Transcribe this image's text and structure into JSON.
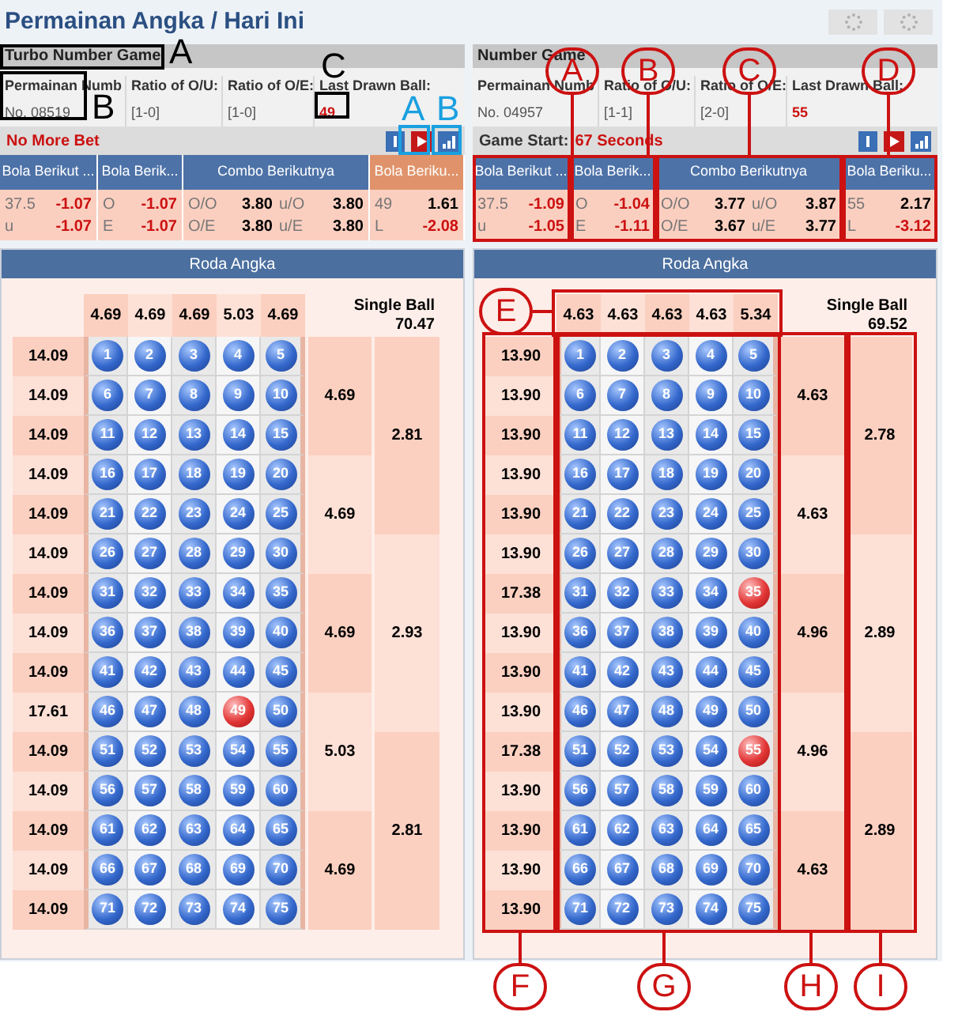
{
  "page_title": "Permainan Angka / Hari Ini",
  "panels": [
    {
      "title": "Turbo Number Game",
      "info": [
        {
          "label": "Permainan Numb",
          "value": "No. 08519"
        },
        {
          "label": "Ratio of O/U:",
          "value": "[1-0]"
        },
        {
          "label": "Ratio of O/E:",
          "value": "[1-0]"
        },
        {
          "label": "Last Drawn Ball:",
          "value": "49"
        }
      ],
      "status": {
        "value": "No More Bet"
      },
      "markets": [
        {
          "title": "Bola Berikut ...",
          "highlighted": false,
          "lines": [
            [
              {
                "text": "37.5",
                "kind": "label"
              },
              {
                "text": "-1.07",
                "kind": "neg"
              }
            ],
            [
              {
                "text": "u",
                "kind": "label"
              },
              {
                "text": "-1.07",
                "kind": "neg"
              }
            ]
          ]
        },
        {
          "title": "Bola Berik...",
          "highlighted": false,
          "lines": [
            [
              {
                "text": "O",
                "kind": "label"
              },
              {
                "text": "-1.07",
                "kind": "neg"
              }
            ],
            [
              {
                "text": "E",
                "kind": "label"
              },
              {
                "text": "-1.07",
                "kind": "neg"
              }
            ]
          ]
        },
        {
          "title": "Combo Berikutnya",
          "highlighted": false,
          "lines": [
            [
              {
                "text": "O/O",
                "kind": "label"
              },
              {
                "text": "3.80",
                "kind": "pos"
              },
              {
                "text": "u/O",
                "kind": "label"
              },
              {
                "text": "3.80",
                "kind": "pos"
              }
            ],
            [
              {
                "text": "O/E",
                "kind": "label"
              },
              {
                "text": "3.80",
                "kind": "pos"
              },
              {
                "text": "u/E",
                "kind": "label"
              },
              {
                "text": "3.80",
                "kind": "pos"
              }
            ]
          ]
        },
        {
          "title": "Bola Beriku...",
          "highlighted": true,
          "lines": [
            [
              {
                "text": "49",
                "kind": "label"
              },
              {
                "text": "1.61",
                "kind": "pos"
              }
            ],
            [
              {
                "text": "L",
                "kind": "label"
              },
              {
                "text": "-2.08",
                "kind": "neg"
              }
            ]
          ]
        }
      ],
      "grid": {
        "title": "Roda Angka",
        "column_odds": [
          "4.69",
          "4.69",
          "4.69",
          "5.03",
          "4.69"
        ],
        "single_label": "Single Ball",
        "single_odds": "70.47",
        "row_odds": [
          "14.09",
          "14.09",
          "14.09",
          "14.09",
          "14.09",
          "14.09",
          "14.09",
          "14.09",
          "14.09",
          "17.61",
          "14.09",
          "14.09",
          "14.09",
          "14.09",
          "14.09"
        ],
        "balls": [
          {
            "text": "1",
            "hit": false
          },
          {
            "text": "2",
            "hit": false
          },
          {
            "text": "3",
            "hit": false
          },
          {
            "text": "4",
            "hit": false
          },
          {
            "text": "5",
            "hit": false
          },
          {
            "text": "6",
            "hit": false
          },
          {
            "text": "7",
            "hit": false
          },
          {
            "text": "8",
            "hit": false
          },
          {
            "text": "9",
            "hit": false
          },
          {
            "text": "10",
            "hit": false
          },
          {
            "text": "11",
            "hit": false
          },
          {
            "text": "12",
            "hit": false
          },
          {
            "text": "13",
            "hit": false
          },
          {
            "text": "14",
            "hit": false
          },
          {
            "text": "15",
            "hit": false
          },
          {
            "text": "16",
            "hit": false
          },
          {
            "text": "17",
            "hit": false
          },
          {
            "text": "18",
            "hit": false
          },
          {
            "text": "19",
            "hit": false
          },
          {
            "text": "20",
            "hit": false
          },
          {
            "text": "21",
            "hit": false
          },
          {
            "text": "22",
            "hit": false
          },
          {
            "text": "23",
            "hit": false
          },
          {
            "text": "24",
            "hit": false
          },
          {
            "text": "25",
            "hit": false
          },
          {
            "text": "26",
            "hit": false
          },
          {
            "text": "27",
            "hit": false
          },
          {
            "text": "28",
            "hit": false
          },
          {
            "text": "29",
            "hit": false
          },
          {
            "text": "30",
            "hit": false
          },
          {
            "text": "31",
            "hit": false
          },
          {
            "text": "32",
            "hit": false
          },
          {
            "text": "33",
            "hit": false
          },
          {
            "text": "34",
            "hit": false
          },
          {
            "text": "35",
            "hit": false
          },
          {
            "text": "36",
            "hit": false
          },
          {
            "text": "37",
            "hit": false
          },
          {
            "text": "38",
            "hit": false
          },
          {
            "text": "39",
            "hit": false
          },
          {
            "text": "40",
            "hit": false
          },
          {
            "text": "41",
            "hit": false
          },
          {
            "text": "42",
            "hit": false
          },
          {
            "text": "43",
            "hit": false
          },
          {
            "text": "44",
            "hit": false
          },
          {
            "text": "45",
            "hit": false
          },
          {
            "text": "46",
            "hit": false
          },
          {
            "text": "47",
            "hit": false
          },
          {
            "text": "48",
            "hit": false
          },
          {
            "text": "49",
            "hit": true
          },
          {
            "text": "50",
            "hit": false
          },
          {
            "text": "51",
            "hit": false
          },
          {
            "text": "52",
            "hit": false
          },
          {
            "text": "53",
            "hit": false
          },
          {
            "text": "54",
            "hit": false
          },
          {
            "text": "55",
            "hit": false
          },
          {
            "text": "56",
            "hit": false
          },
          {
            "text": "57",
            "hit": false
          },
          {
            "text": "58",
            "hit": false
          },
          {
            "text": "59",
            "hit": false
          },
          {
            "text": "60",
            "hit": false
          },
          {
            "text": "61",
            "hit": false
          },
          {
            "text": "62",
            "hit": false
          },
          {
            "text": "63",
            "hit": false
          },
          {
            "text": "64",
            "hit": false
          },
          {
            "text": "65",
            "hit": false
          },
          {
            "text": "66",
            "hit": false
          },
          {
            "text": "67",
            "hit": false
          },
          {
            "text": "68",
            "hit": false
          },
          {
            "text": "69",
            "hit": false
          },
          {
            "text": "70",
            "hit": false
          },
          {
            "text": "71",
            "hit": false
          },
          {
            "text": "72",
            "hit": false
          },
          {
            "text": "73",
            "hit": false
          },
          {
            "text": "74",
            "hit": false
          },
          {
            "text": "75",
            "hit": false
          }
        ],
        "groups": [
          "4.69",
          "4.69",
          "4.69",
          "5.03",
          "4.69"
        ],
        "singles": [
          "2.81",
          "2.93",
          "2.81"
        ]
      }
    },
    {
      "title": "Number Game",
      "info": [
        {
          "label": "Permainan Numb",
          "value": "No. 04957"
        },
        {
          "label": "Ratio of O/U:",
          "value": "[1-1]"
        },
        {
          "label": "Ratio of O/E:",
          "value": "[2-0]"
        },
        {
          "label": "Last Drawn Ball:",
          "value": "55"
        }
      ],
      "status": {
        "label": "Game Start:",
        "value": "67 Seconds"
      },
      "markets": [
        {
          "title": "Bola Berikut ...",
          "highlighted": false,
          "lines": [
            [
              {
                "text": "37.5",
                "kind": "label"
              },
              {
                "text": "-1.09",
                "kind": "neg"
              }
            ],
            [
              {
                "text": "u",
                "kind": "label"
              },
              {
                "text": "-1.05",
                "kind": "neg"
              }
            ]
          ]
        },
        {
          "title": "Bola Berik...",
          "highlighted": false,
          "lines": [
            [
              {
                "text": "O",
                "kind": "label"
              },
              {
                "text": "-1.04",
                "kind": "neg"
              }
            ],
            [
              {
                "text": "E",
                "kind": "label"
              },
              {
                "text": "-1.11",
                "kind": "neg"
              }
            ]
          ]
        },
        {
          "title": "Combo Berikutnya",
          "highlighted": false,
          "lines": [
            [
              {
                "text": "O/O",
                "kind": "label"
              },
              {
                "text": "3.77",
                "kind": "pos"
              },
              {
                "text": "u/O",
                "kind": "label"
              },
              {
                "text": "3.87",
                "kind": "pos"
              }
            ],
            [
              {
                "text": "O/E",
                "kind": "label"
              },
              {
                "text": "3.67",
                "kind": "pos"
              },
              {
                "text": "u/E",
                "kind": "label"
              },
              {
                "text": "3.77",
                "kind": "pos"
              }
            ]
          ]
        },
        {
          "title": "Bola Beriku...",
          "highlighted": false,
          "lines": [
            [
              {
                "text": "55",
                "kind": "label"
              },
              {
                "text": "2.17",
                "kind": "pos"
              }
            ],
            [
              {
                "text": "L",
                "kind": "label"
              },
              {
                "text": "-3.12",
                "kind": "neg"
              }
            ]
          ]
        }
      ],
      "grid": {
        "title": "Roda Angka",
        "column_odds": [
          "4.63",
          "4.63",
          "4.63",
          "4.63",
          "5.34"
        ],
        "single_label": "Single Ball",
        "single_odds": "69.52",
        "row_odds": [
          "13.90",
          "13.90",
          "13.90",
          "13.90",
          "13.90",
          "13.90",
          "17.38",
          "13.90",
          "13.90",
          "13.90",
          "17.38",
          "13.90",
          "13.90",
          "13.90",
          "13.90"
        ],
        "balls": [
          {
            "text": "1",
            "hit": false
          },
          {
            "text": "2",
            "hit": false
          },
          {
            "text": "3",
            "hit": false
          },
          {
            "text": "4",
            "hit": false
          },
          {
            "text": "5",
            "hit": false
          },
          {
            "text": "6",
            "hit": false
          },
          {
            "text": "7",
            "hit": false
          },
          {
            "text": "8",
            "hit": false
          },
          {
            "text": "9",
            "hit": false
          },
          {
            "text": "10",
            "hit": false
          },
          {
            "text": "11",
            "hit": false
          },
          {
            "text": "12",
            "hit": false
          },
          {
            "text": "13",
            "hit": false
          },
          {
            "text": "14",
            "hit": false
          },
          {
            "text": "15",
            "hit": false
          },
          {
            "text": "16",
            "hit": false
          },
          {
            "text": "17",
            "hit": false
          },
          {
            "text": "18",
            "hit": false
          },
          {
            "text": "19",
            "hit": false
          },
          {
            "text": "20",
            "hit": false
          },
          {
            "text": "21",
            "hit": false
          },
          {
            "text": "22",
            "hit": false
          },
          {
            "text": "23",
            "hit": false
          },
          {
            "text": "24",
            "hit": false
          },
          {
            "text": "25",
            "hit": false
          },
          {
            "text": "26",
            "hit": false
          },
          {
            "text": "27",
            "hit": false
          },
          {
            "text": "28",
            "hit": false
          },
          {
            "text": "29",
            "hit": false
          },
          {
            "text": "30",
            "hit": false
          },
          {
            "text": "31",
            "hit": false
          },
          {
            "text": "32",
            "hit": false
          },
          {
            "text": "33",
            "hit": false
          },
          {
            "text": "34",
            "hit": false
          },
          {
            "text": "35",
            "hit": true
          },
          {
            "text": "36",
            "hit": false
          },
          {
            "text": "37",
            "hit": false
          },
          {
            "text": "38",
            "hit": false
          },
          {
            "text": "39",
            "hit": false
          },
          {
            "text": "40",
            "hit": false
          },
          {
            "text": "41",
            "hit": false
          },
          {
            "text": "42",
            "hit": false
          },
          {
            "text": "43",
            "hit": false
          },
          {
            "text": "44",
            "hit": false
          },
          {
            "text": "45",
            "hit": false
          },
          {
            "text": "46",
            "hit": false
          },
          {
            "text": "47",
            "hit": false
          },
          {
            "text": "48",
            "hit": false
          },
          {
            "text": "49",
            "hit": false
          },
          {
            "text": "50",
            "hit": false
          },
          {
            "text": "51",
            "hit": false
          },
          {
            "text": "52",
            "hit": false
          },
          {
            "text": "53",
            "hit": false
          },
          {
            "text": "54",
            "hit": false
          },
          {
            "text": "55",
            "hit": true
          },
          {
            "text": "56",
            "hit": false
          },
          {
            "text": "57",
            "hit": false
          },
          {
            "text": "58",
            "hit": false
          },
          {
            "text": "59",
            "hit": false
          },
          {
            "text": "60",
            "hit": false
          },
          {
            "text": "61",
            "hit": false
          },
          {
            "text": "62",
            "hit": false
          },
          {
            "text": "63",
            "hit": false
          },
          {
            "text": "64",
            "hit": false
          },
          {
            "text": "65",
            "hit": false
          },
          {
            "text": "66",
            "hit": false
          },
          {
            "text": "67",
            "hit": false
          },
          {
            "text": "68",
            "hit": false
          },
          {
            "text": "69",
            "hit": false
          },
          {
            "text": "70",
            "hit": false
          },
          {
            "text": "71",
            "hit": false
          },
          {
            "text": "72",
            "hit": false
          },
          {
            "text": "73",
            "hit": false
          },
          {
            "text": "74",
            "hit": false
          },
          {
            "text": "75",
            "hit": false
          }
        ],
        "groups": [
          "4.63",
          "4.63",
          "4.96",
          "4.96",
          "4.63"
        ],
        "singles": [
          "2.78",
          "2.89",
          "2.89"
        ]
      }
    }
  ],
  "annotations": [
    {
      "label": "A",
      "kind": "black"
    },
    {
      "label": "B",
      "kind": "black"
    },
    {
      "label": "C",
      "kind": "black"
    },
    {
      "label": "A",
      "kind": "cyan"
    },
    {
      "label": "B",
      "kind": "cyan"
    },
    {
      "label": "A",
      "kind": "red"
    },
    {
      "label": "B",
      "kind": "red"
    },
    {
      "label": "C",
      "kind": "red"
    },
    {
      "label": "D",
      "kind": "red"
    },
    {
      "label": "E",
      "kind": "red"
    },
    {
      "label": "F",
      "kind": "red"
    },
    {
      "label": "G",
      "kind": "red"
    },
    {
      "label": "H",
      "kind": "red"
    },
    {
      "label": "I",
      "kind": "red"
    }
  ]
}
